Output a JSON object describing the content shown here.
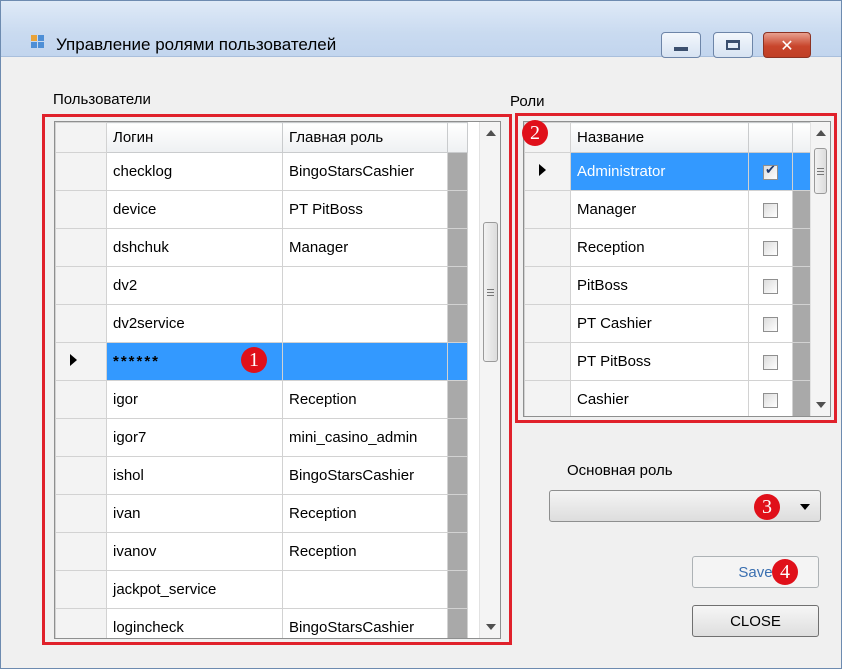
{
  "window": {
    "title": "Управление ролями пользователей",
    "controls": {
      "minimize": "minimize",
      "maximize": "maximize",
      "close": "✕"
    }
  },
  "users": {
    "label": "Пользователи",
    "columns": [
      "Логин",
      "Главная роль"
    ],
    "rows": [
      {
        "login": "checklog",
        "role": "BingoStarsCashier"
      },
      {
        "login": "device",
        "role": "PT PitBoss"
      },
      {
        "login": "dshchuk",
        "role": "Manager"
      },
      {
        "login": "dv2",
        "role": ""
      },
      {
        "login": "dv2service",
        "role": ""
      },
      {
        "login": "******",
        "role": "",
        "selected": true
      },
      {
        "login": "igor",
        "role": "Reception"
      },
      {
        "login": "igor7",
        "role": "mini_casino_admin"
      },
      {
        "login": "ishol",
        "role": "BingoStarsCashier"
      },
      {
        "login": "ivan",
        "role": "Reception"
      },
      {
        "login": "ivanov",
        "role": "Reception"
      },
      {
        "login": "jackpot_service",
        "role": ""
      },
      {
        "login": "logincheck",
        "role": "BingoStarsCashier"
      }
    ]
  },
  "roles": {
    "label": "Роли",
    "column": "Название",
    "rows": [
      {
        "name": "Administrator",
        "checked": true,
        "selected": true
      },
      {
        "name": "Manager",
        "checked": false
      },
      {
        "name": "Reception",
        "checked": false
      },
      {
        "name": "PitBoss",
        "checked": false
      },
      {
        "name": "PT Cashier",
        "checked": false
      },
      {
        "name": "PT PitBoss",
        "checked": false
      },
      {
        "name": "Cashier",
        "checked": false
      }
    ]
  },
  "main_role": {
    "label": "Основная роль",
    "value": ""
  },
  "buttons": {
    "save": "Save",
    "close": "CLOSE"
  },
  "badges": [
    "1",
    "2",
    "3",
    "4"
  ],
  "colors": {
    "highlight": "#e0212b",
    "selection": "#3399ff"
  }
}
